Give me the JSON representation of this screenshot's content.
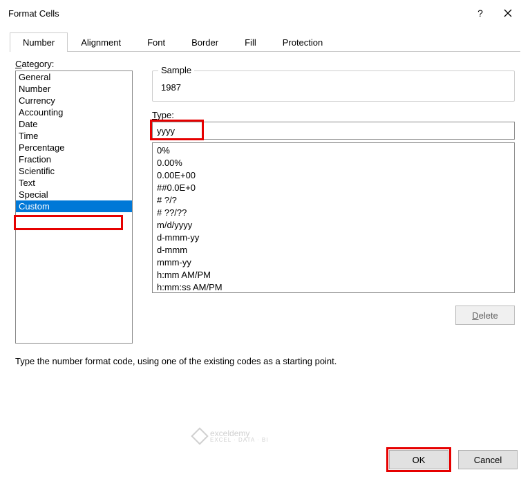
{
  "title": "Format Cells",
  "tabs": [
    "Number",
    "Alignment",
    "Font",
    "Border",
    "Fill",
    "Protection"
  ],
  "active_tab": 0,
  "category_label": "Category:",
  "categories": [
    "General",
    "Number",
    "Currency",
    "Accounting",
    "Date",
    "Time",
    "Percentage",
    "Fraction",
    "Scientific",
    "Text",
    "Special",
    "Custom"
  ],
  "selected_category_index": 11,
  "sample_label": "Sample",
  "sample_value": "1987",
  "type_label": "Type:",
  "type_value": "yyyy",
  "type_list": [
    "0%",
    "0.00%",
    "0.00E+00",
    "##0.0E+0",
    "# ?/?",
    "# ??/??",
    "m/d/yyyy",
    "d-mmm-yy",
    "d-mmm",
    "mmm-yy",
    "h:mm AM/PM",
    "h:mm:ss AM/PM"
  ],
  "delete_label": "Delete",
  "help_text": "Type the number format code, using one of the existing codes as a starting point.",
  "ok_label": "OK",
  "cancel_label": "Cancel",
  "watermark": {
    "brand": "exceldemy",
    "sub": "EXCEL · DATA · BI"
  }
}
